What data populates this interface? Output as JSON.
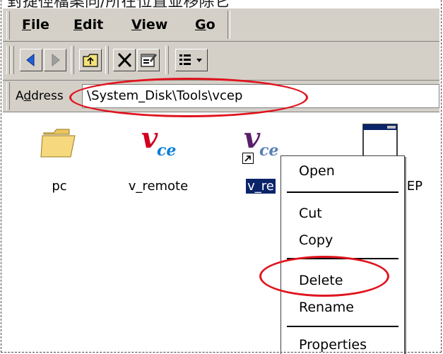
{
  "caption": {
    "text": "對捷徑檔案同/所在位置並移除它"
  },
  "menubar": {
    "items": [
      {
        "prefix": "F",
        "rest": "ile"
      },
      {
        "prefix": "E",
        "rest": "dit"
      },
      {
        "prefix": "V",
        "rest": "iew"
      },
      {
        "prefix": "G",
        "rest": "o"
      }
    ]
  },
  "toolbar": {
    "buttons": [
      "back-icon",
      "forward-icon",
      "up-folder-icon",
      "delete-icon",
      "properties-icon",
      "views-icon"
    ]
  },
  "address": {
    "label_prefix": "A",
    "label_accel": "d",
    "label_rest": "dress",
    "value": "\\System_Disk\\Tools\\vcep"
  },
  "files": [
    {
      "name": "pc",
      "icon": "folder-icon",
      "selected": false
    },
    {
      "name": "v_remote",
      "icon": "vce-icon",
      "selected": false
    },
    {
      "name": "v_re",
      "icon": "vce-shortcut-icon",
      "selected": true
    },
    {
      "name": "CEP",
      "icon": "app-window-icon",
      "selected": false
    }
  ],
  "context_menu": {
    "items": [
      "Open",
      "Cut",
      "Copy",
      "Delete",
      "Rename",
      "Properties"
    ]
  },
  "icon_glyph": {
    "v": "v",
    "ce": "ce"
  },
  "colors": {
    "chrome": "#d4d0c8",
    "selection": "#0a246a",
    "annotation_red": "#e0141e",
    "caption_highlight": "#f7cd89"
  }
}
